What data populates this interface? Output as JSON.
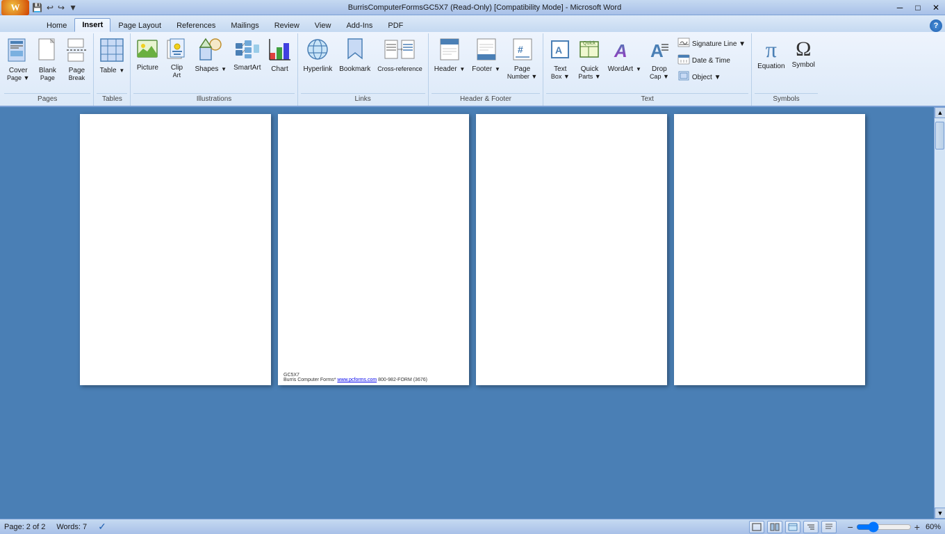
{
  "titlebar": {
    "title": "BurrisComputerFormsGC5X7 (Read-Only) [Compatibility Mode] - Microsoft Word",
    "min": "─",
    "restore": "□",
    "close": "✕"
  },
  "tabs": [
    {
      "id": "home",
      "label": "Home",
      "active": false
    },
    {
      "id": "insert",
      "label": "Insert",
      "active": true
    },
    {
      "id": "pagelayout",
      "label": "Page Layout",
      "active": false
    },
    {
      "id": "references",
      "label": "References",
      "active": false
    },
    {
      "id": "mailings",
      "label": "Mailings",
      "active": false
    },
    {
      "id": "review",
      "label": "Review",
      "active": false
    },
    {
      "id": "view",
      "label": "View",
      "active": false
    },
    {
      "id": "addins",
      "label": "Add-Ins",
      "active": false
    },
    {
      "id": "pdf",
      "label": "PDF",
      "active": false
    }
  ],
  "ribbon": {
    "groups": [
      {
        "id": "pages",
        "label": "Pages",
        "items": [
          {
            "id": "cover-page",
            "icon": "📄",
            "label": "Cover",
            "sublabel": "Page",
            "hasDropdown": true
          },
          {
            "id": "blank-page",
            "icon": "📋",
            "label": "Blank",
            "sublabel": "Page",
            "hasDropdown": false
          },
          {
            "id": "page-break",
            "icon": "⬛",
            "label": "Page",
            "sublabel": "Break",
            "hasDropdown": false
          }
        ]
      },
      {
        "id": "tables",
        "label": "Tables",
        "items": [
          {
            "id": "table",
            "icon": "⊞",
            "label": "Table",
            "hasDropdown": true
          }
        ]
      },
      {
        "id": "illustrations",
        "label": "Illustrations",
        "items": [
          {
            "id": "picture",
            "icon": "🖼",
            "label": "Picture",
            "hasDropdown": false
          },
          {
            "id": "clip-art",
            "icon": "✂",
            "label": "Clip",
            "sublabel": "Art",
            "hasDropdown": false
          },
          {
            "id": "shapes",
            "icon": "◻",
            "label": "Shapes",
            "hasDropdown": true
          },
          {
            "id": "smartart",
            "icon": "🔷",
            "label": "SmartArt",
            "hasDropdown": false
          },
          {
            "id": "chart",
            "icon": "📊",
            "label": "Chart",
            "hasDropdown": false
          }
        ]
      },
      {
        "id": "links",
        "label": "Links",
        "items": [
          {
            "id": "hyperlink",
            "icon": "🔗",
            "label": "Hyperlink",
            "hasDropdown": false
          },
          {
            "id": "bookmark",
            "icon": "🔖",
            "label": "Bookmark",
            "hasDropdown": false
          },
          {
            "id": "cross-reference",
            "icon": "↔",
            "label": "Cross-reference",
            "hasDropdown": false
          }
        ]
      },
      {
        "id": "header-footer",
        "label": "Header & Footer",
        "items": [
          {
            "id": "header",
            "icon": "⬆",
            "label": "Header",
            "hasDropdown": true
          },
          {
            "id": "footer",
            "icon": "⬇",
            "label": "Footer",
            "hasDropdown": true
          },
          {
            "id": "page-number",
            "icon": "#",
            "label": "Page",
            "sublabel": "Number",
            "hasDropdown": true
          }
        ]
      },
      {
        "id": "text",
        "label": "Text",
        "items": [
          {
            "id": "text-box",
            "icon": "📝",
            "label": "Text",
            "sublabel": "Box",
            "hasDropdown": true
          },
          {
            "id": "quick-parts",
            "icon": "⚡",
            "label": "Quick",
            "sublabel": "Parts",
            "hasDropdown": true
          },
          {
            "id": "wordart",
            "icon": "A",
            "label": "WordArt",
            "hasDropdown": true
          },
          {
            "id": "drop-cap",
            "icon": "A",
            "label": "Drop",
            "sublabel": "Cap",
            "hasDropdown": true
          }
        ],
        "smallItems": [
          {
            "id": "signature-line",
            "icon": "✏",
            "label": "Signature Line",
            "hasDropdown": true
          },
          {
            "id": "date-time",
            "icon": "📅",
            "label": "Date & Time",
            "hasDropdown": false
          },
          {
            "id": "object",
            "icon": "◈",
            "label": "Object",
            "hasDropdown": true
          }
        ]
      },
      {
        "id": "symbols",
        "label": "Symbols",
        "items": [
          {
            "id": "equation",
            "icon": "π",
            "label": "Equation",
            "hasDropdown": false
          },
          {
            "id": "symbol",
            "icon": "Ω",
            "label": "Symbol",
            "hasDropdown": false
          }
        ]
      }
    ]
  },
  "pages": [
    {
      "id": "page1",
      "hasFooter": false
    },
    {
      "id": "page2",
      "hasFooter": true,
      "footerCode": "GC5X7",
      "footerText": "Burris Computer Forms* www.pcforms.com 800-982-FORM (3676)"
    },
    {
      "id": "page3",
      "hasFooter": false
    },
    {
      "id": "page4",
      "hasFooter": false
    }
  ],
  "statusbar": {
    "page": "Page: 2 of 2",
    "words": "Words: 7",
    "zoom": "60%"
  }
}
